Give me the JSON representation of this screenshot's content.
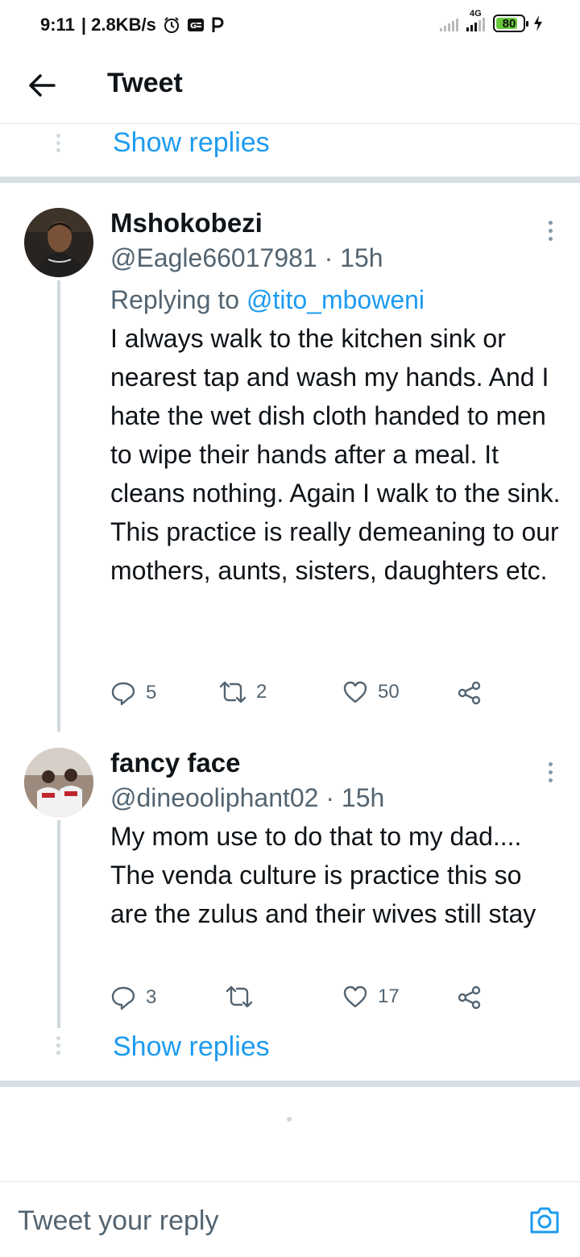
{
  "status_bar": {
    "time": "9:11",
    "speed": "| 2.8KB/s",
    "network": "4G",
    "battery": "80",
    "battery_level": 0.8
  },
  "header": {
    "title": "Tweet"
  },
  "top_show_replies": {
    "label": "Show replies"
  },
  "tweets": [
    {
      "name": "Mshokobezi",
      "handle": "@Eagle66017981 · 15h",
      "replying_prefix": "Replying to ",
      "replying_to": "@tito_mboweni",
      "text": "I always walk to the kitchen sink or nearest tap and wash my hands. And I hate the wet dish cloth handed to men to wipe their hands after a meal. It cleans nothing. Again I walk to the sink. This practice is really demeaning to our mothers, aunts, sisters, daughters etc.",
      "replies": "5",
      "retweets": "2",
      "likes": "50"
    },
    {
      "name": "fancy face",
      "handle": "@dineooliphant02 · 15h",
      "text": "My mom use to do that to my dad.... The venda culture is practice this so are the zulus and their wives still stay",
      "replies": "3",
      "retweets": "",
      "likes": "17"
    }
  ],
  "bottom_show_replies": {
    "label": "Show replies"
  },
  "reply_bar": {
    "placeholder": "Tweet your reply"
  },
  "colors": {
    "accent": "#1d9bf0",
    "text": "#0f1419",
    "secondary": "#536471",
    "separator": "#d9e0e5"
  },
  "icons": {
    "back": "arrow-left-icon",
    "more": "more-vertical-icon",
    "reply": "comment-icon",
    "retweet": "retweet-icon",
    "like": "heart-icon",
    "share": "share-icon",
    "camera": "camera-icon"
  }
}
